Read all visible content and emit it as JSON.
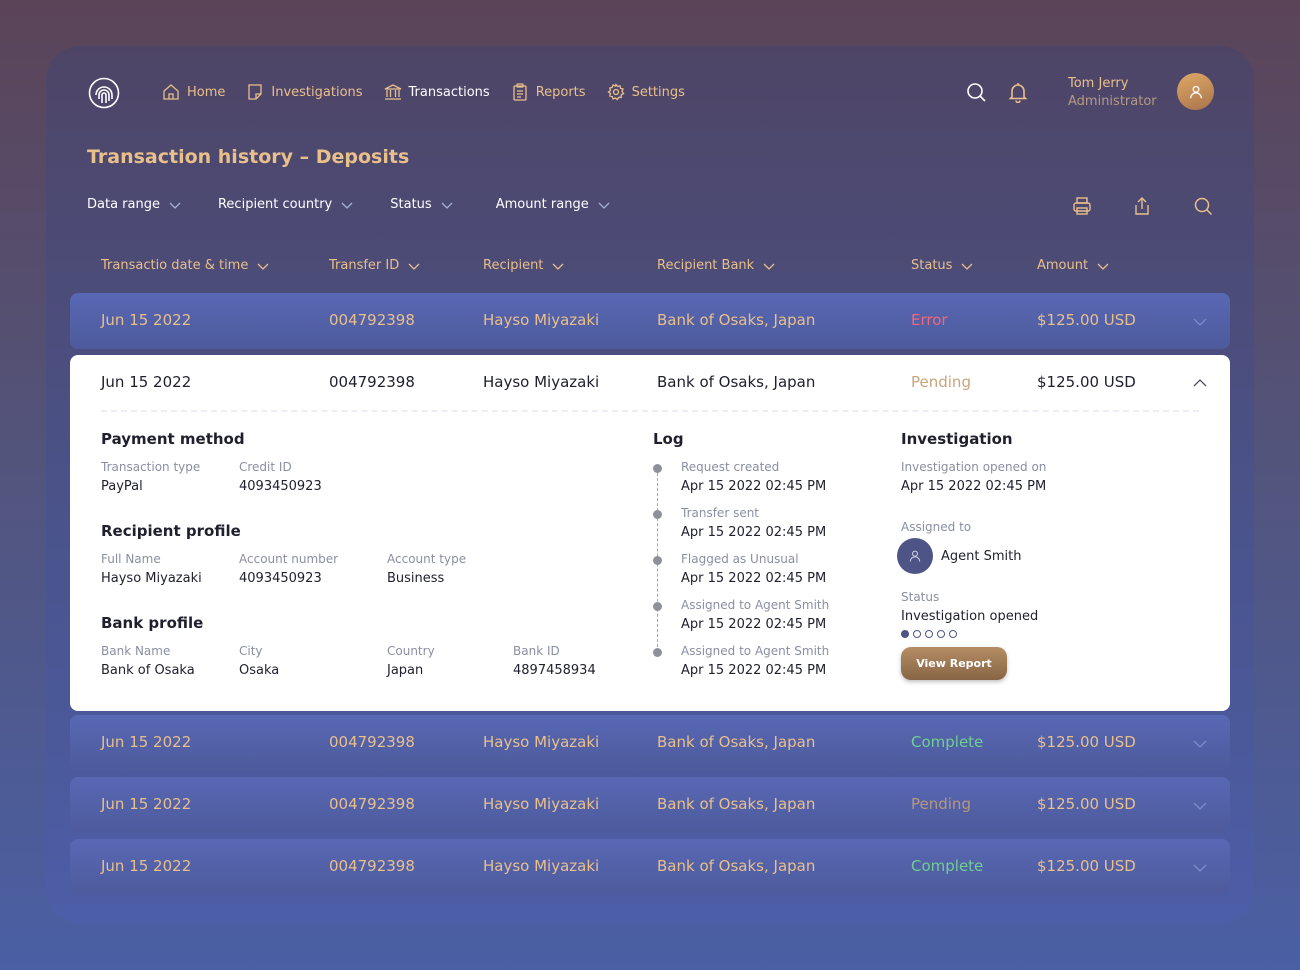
{
  "header": {
    "nav": [
      {
        "label": "Home",
        "icon": "home-icon"
      },
      {
        "label": "Investigations",
        "icon": "note-icon"
      },
      {
        "label": "Transactions",
        "icon": "bank-icon"
      },
      {
        "label": "Reports",
        "icon": "clipboard-icon"
      },
      {
        "label": "Settings",
        "icon": "gear-icon"
      }
    ],
    "active_nav": "Transactions",
    "user": {
      "name": "Tom Jerry",
      "role": "Administrator"
    }
  },
  "page_title": "Transaction history – Deposits",
  "filters": [
    "Data range",
    "Recipient country",
    "Status",
    "Amount range"
  ],
  "table": {
    "columns": [
      "Transactio date & time",
      "Transfer ID",
      "Recipient",
      "Recipient Bank",
      "Status",
      "Amount"
    ],
    "rows": [
      {
        "date": "Jun 15 2022",
        "id": "004792398",
        "recipient": "Hayso Miyazaki",
        "bank": "Bank of Osaks, Japan",
        "status": "Error",
        "amount": "$125.00 USD"
      },
      {
        "date": "Jun 15 2022",
        "id": "004792398",
        "recipient": "Hayso Miyazaki",
        "bank": "Bank of Osaks, Japan",
        "status": "Pending",
        "amount": "$125.00 USD"
      },
      {
        "date": "Jun 15 2022",
        "id": "004792398",
        "recipient": "Hayso Miyazaki",
        "bank": "Bank of Osaks, Japan",
        "status": "Complete",
        "amount": "$125.00 USD"
      },
      {
        "date": "Jun 15 2022",
        "id": "004792398",
        "recipient": "Hayso Miyazaki",
        "bank": "Bank of Osaks, Japan",
        "status": "Pending",
        "amount": "$125.00 USD"
      },
      {
        "date": "Jun 15 2022",
        "id": "004792398",
        "recipient": "Hayso Miyazaki",
        "bank": "Bank of Osaks, Japan",
        "status": "Complete",
        "amount": "$125.00 USD"
      }
    ]
  },
  "details": {
    "payment": {
      "title": "Payment method",
      "type_label": "Transaction type",
      "type": "PayPal",
      "credit_label": "Credit ID",
      "credit": "4093450923"
    },
    "recipient": {
      "title": "Recipient profile",
      "name_label": "Full Name",
      "name": "Hayso Miyazaki",
      "account_label": "Account number",
      "account": "4093450923",
      "acctype_label": "Account type",
      "acctype": "Business"
    },
    "bank": {
      "title": "Bank profile",
      "name_label": "Bank Name",
      "name": "Bank of Osaka",
      "city_label": "City",
      "city": "Osaka",
      "country_label": "Country",
      "country": "Japan",
      "id_label": "Bank ID",
      "id": "4897458934"
    },
    "log": {
      "title": "Log",
      "entries": [
        {
          "event": "Request created",
          "time": "Apr 15 2022 02:45 PM"
        },
        {
          "event": "Transfer sent",
          "time": "Apr 15 2022 02:45 PM"
        },
        {
          "event": "Flagged as Unusual",
          "time": "Apr 15 2022 02:45 PM"
        },
        {
          "event": "Assigned to Agent Smith",
          "time": "Apr 15 2022 02:45 PM"
        },
        {
          "event": "Assigned to Agent Smith",
          "time": "Apr 15 2022 02:45 PM"
        }
      ]
    },
    "investigation": {
      "title": "Investigation",
      "opened_label": "Investigation opened on",
      "opened": "Apr 15 2022 02:45 PM",
      "assigned_label": "Assigned to",
      "assigned": "Agent Smith",
      "status_label": "Status",
      "status": "Investigation opened",
      "progress_step": 1,
      "progress_total": 5,
      "button": "View Report"
    }
  },
  "colors": {
    "accent": "#e9bf8a",
    "error": "#f2677a",
    "pending": "#c9a57c",
    "complete": "#6fcf8f"
  }
}
